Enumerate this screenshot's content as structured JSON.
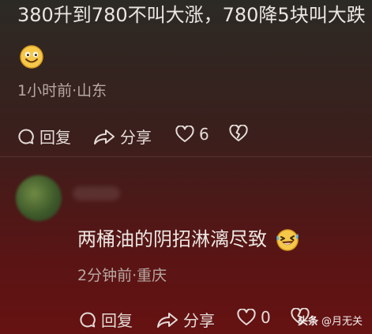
{
  "comment1": {
    "text": "380升到780不叫大涨，780降5块叫大跌",
    "emoji": "smiling-face-emoji",
    "meta": "1小时前·山东",
    "reply_label": "回复",
    "share_label": "分享",
    "like_count": "6"
  },
  "comment2": {
    "text": "两桶油的阴招淋漓尽致",
    "emoji": "laughing-tears-emoji",
    "meta": "2分钟前·重庆",
    "reply_label": "回复",
    "share_label": "分享",
    "like_count": "0"
  },
  "watermark": {
    "brand": "头条",
    "user": "@月无关"
  },
  "colors": {
    "text": "#ece6e2",
    "meta": "#b7a9a4",
    "background_top": "#2c2a25",
    "background_bottom": "#661212"
  }
}
